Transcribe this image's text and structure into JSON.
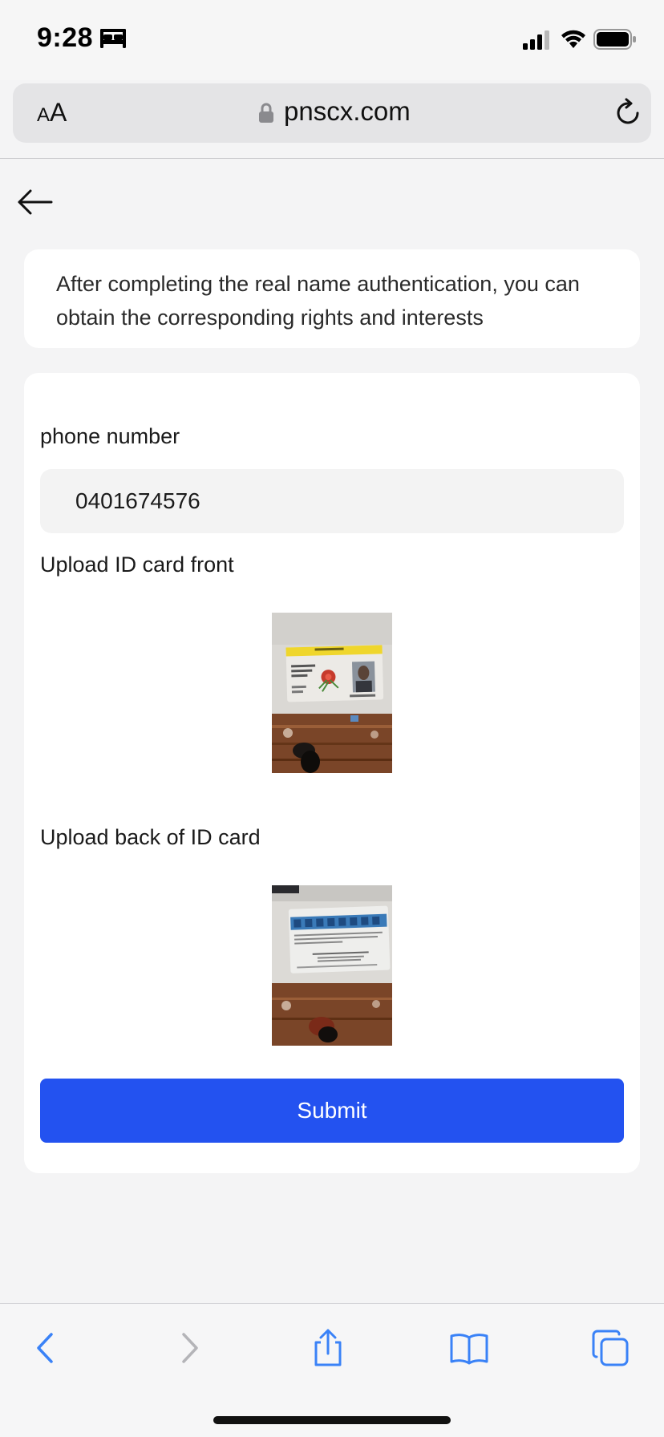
{
  "status": {
    "time": "9:28"
  },
  "browser": {
    "text_size_label_small": "A",
    "text_size_label_large": "A",
    "url": "pnscx.com"
  },
  "page": {
    "notice": "After completing the real name authentication, you can obtain the corresponding rights and interests",
    "form": {
      "phone_label": "phone number",
      "phone_value": "0401674576",
      "front_label": "Upload ID card front",
      "back_label": "Upload back of ID card",
      "submit_label": "Submit"
    }
  },
  "colors": {
    "accent": "#2352f0",
    "browser_tint": "#3a82f7",
    "background": "#f4f4f5"
  },
  "icons": [
    "bed-icon",
    "signal-icon",
    "wifi-icon",
    "battery-icon",
    "lock-icon",
    "reload-icon",
    "back-arrow-icon",
    "chevron-left-icon",
    "chevron-right-icon",
    "share-icon",
    "bookmarks-icon",
    "tabs-icon"
  ]
}
